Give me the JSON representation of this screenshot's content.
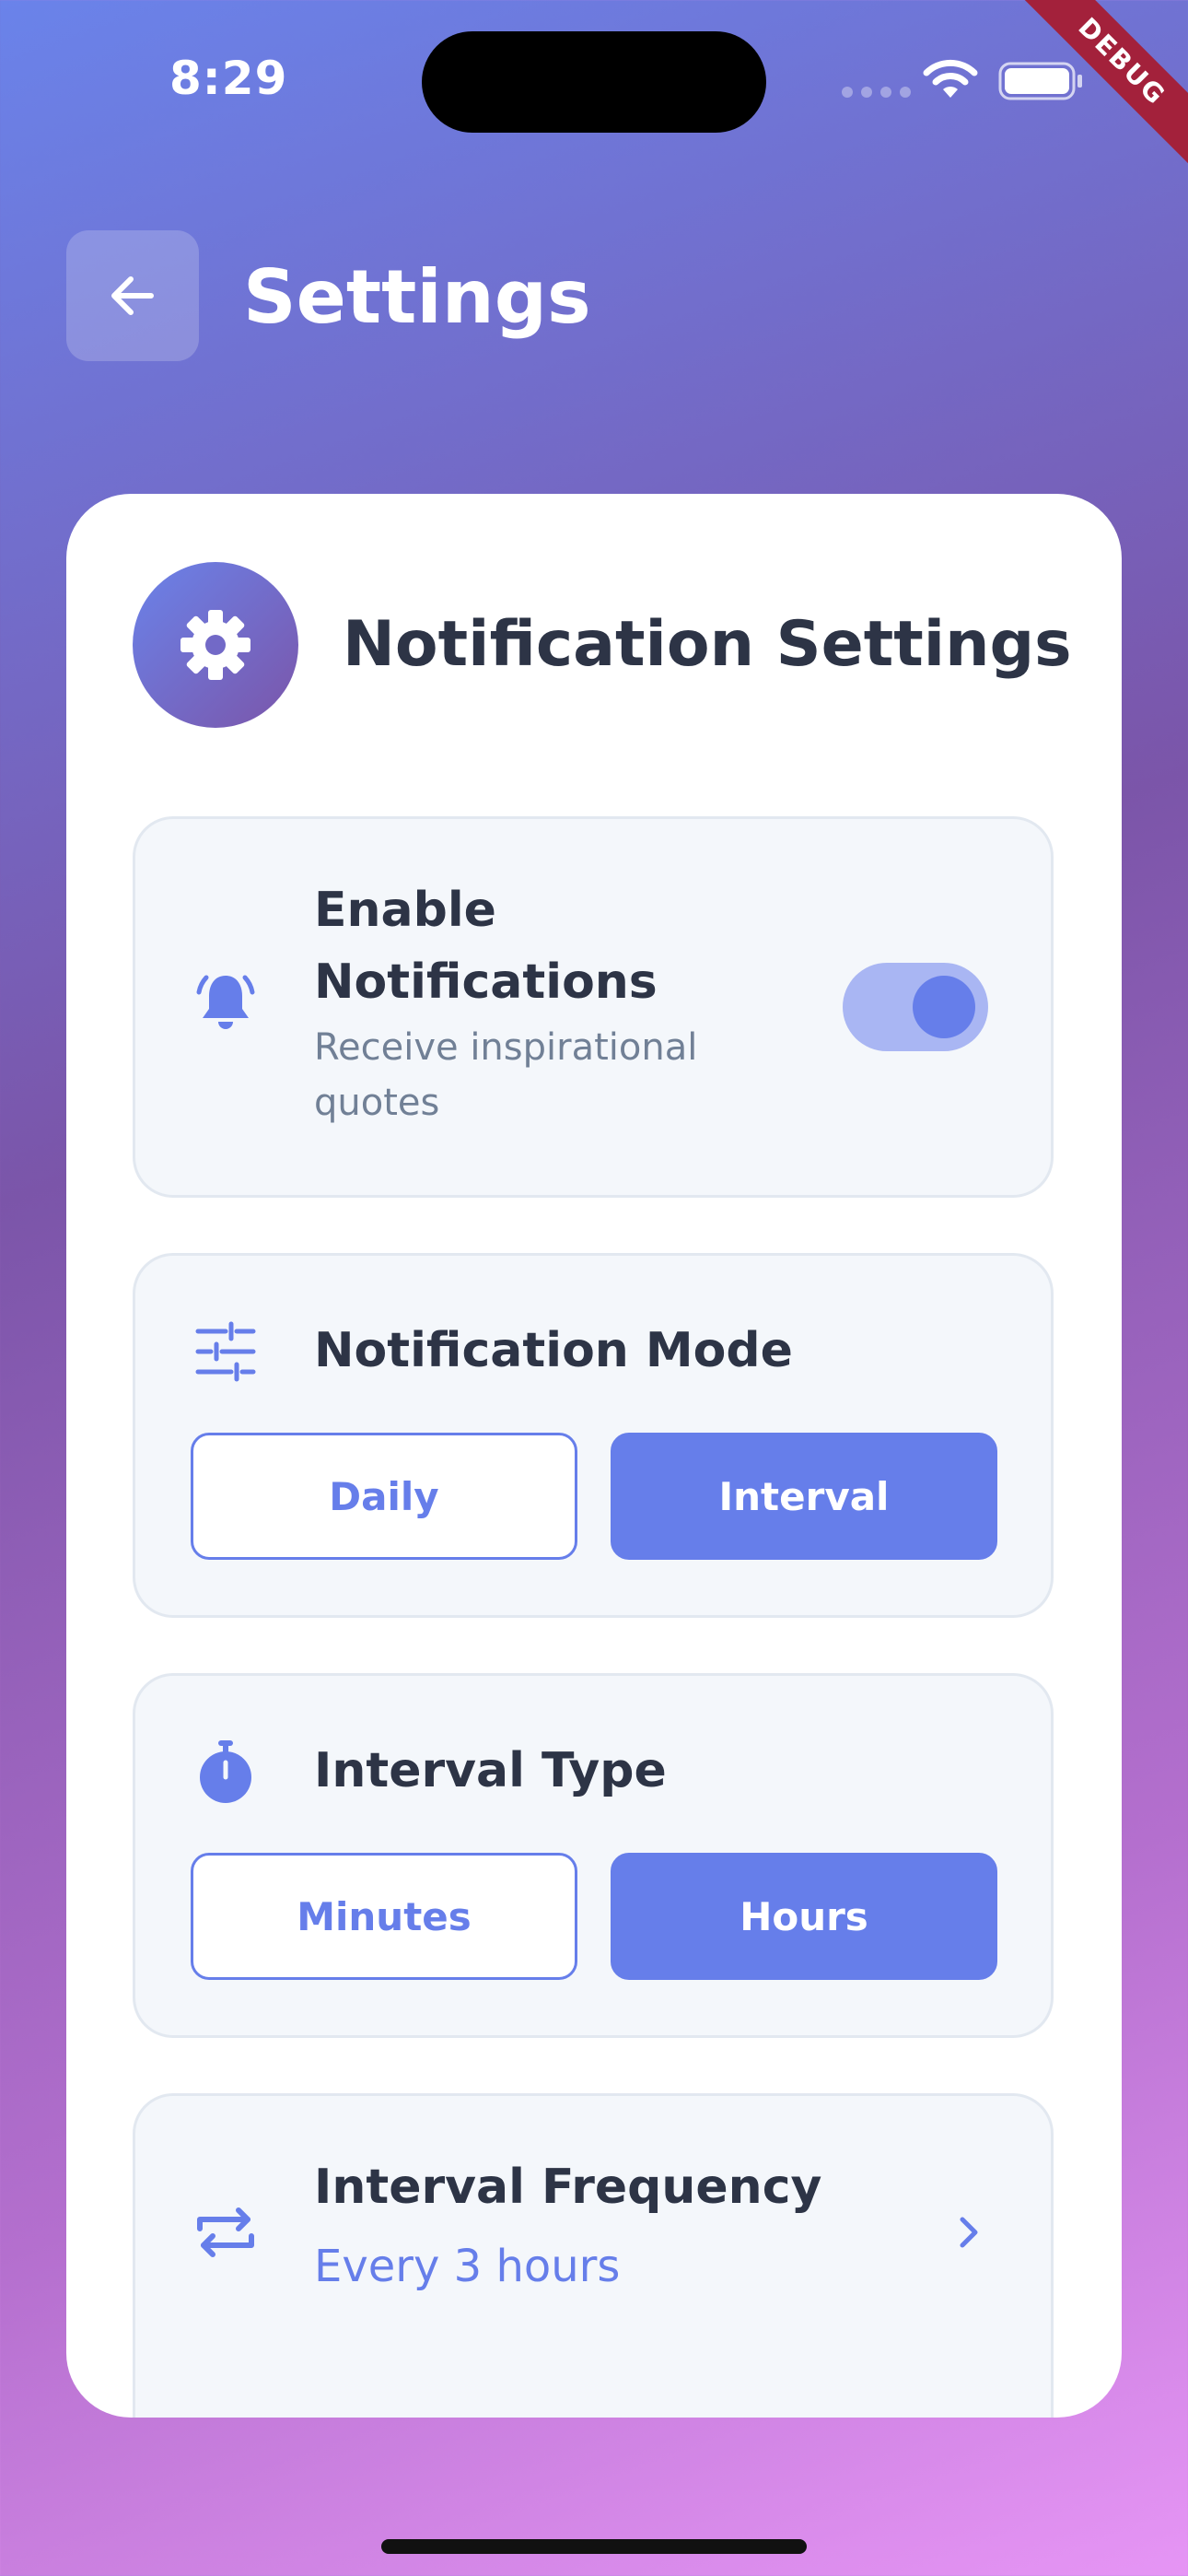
{
  "status_bar": {
    "time": "8:29",
    "debug_label": "DEBUG"
  },
  "header": {
    "title": "Settings",
    "back_icon": "arrow-left-icon"
  },
  "card": {
    "title": "Notification Settings",
    "icon": "gear-icon",
    "enable": {
      "title": "Enable Notifications",
      "subtitle": "Receive inspirational quotes",
      "icon": "bell-icon",
      "toggle_on": true
    },
    "mode": {
      "title": "Notification Mode",
      "icon": "sliders-icon",
      "options": [
        "Daily",
        "Interval"
      ],
      "selected": "Interval"
    },
    "interval_type": {
      "title": "Interval Type",
      "icon": "timer-icon",
      "options": [
        "Minutes",
        "Hours"
      ],
      "selected": "Hours"
    },
    "frequency": {
      "title": "Interval Frequency",
      "value": "Every 3 hours",
      "icon": "repeat-icon"
    }
  },
  "colors": {
    "accent": "#667eea",
    "text": "#2d3446",
    "muted": "#718096"
  }
}
